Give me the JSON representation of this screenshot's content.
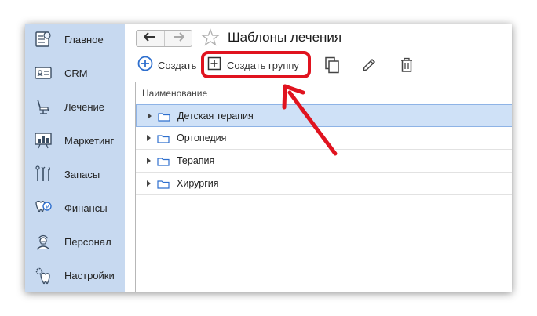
{
  "sidebar": {
    "items": [
      {
        "label": "Главное",
        "icon": "home-tooth-icon"
      },
      {
        "label": "CRM",
        "icon": "id-card-icon"
      },
      {
        "label": "Лечение",
        "icon": "dental-chair-icon"
      },
      {
        "label": "Маркетинг",
        "icon": "chart-board-icon"
      },
      {
        "label": "Запасы",
        "icon": "dental-tools-icon"
      },
      {
        "label": "Финансы",
        "icon": "tooth-coin-icon"
      },
      {
        "label": "Персонал",
        "icon": "doctor-icon"
      },
      {
        "label": "Настройки",
        "icon": "tooth-gear-icon"
      }
    ]
  },
  "header": {
    "title": "Шаблоны лечения"
  },
  "toolbar": {
    "create_label": "Создать",
    "create_group_label": "Создать группу"
  },
  "table": {
    "column_header": "Наименование",
    "rows": [
      {
        "label": "Детская терапия",
        "selected": true
      },
      {
        "label": "Ортопедия",
        "selected": false
      },
      {
        "label": "Терапия",
        "selected": false
      },
      {
        "label": "Хирургия",
        "selected": false
      }
    ]
  },
  "colors": {
    "sidebar_bg": "#c7d9f0",
    "selection_bg": "#cfe1f7",
    "highlight_red": "#e0131f",
    "accent_blue": "#2e6fce"
  }
}
